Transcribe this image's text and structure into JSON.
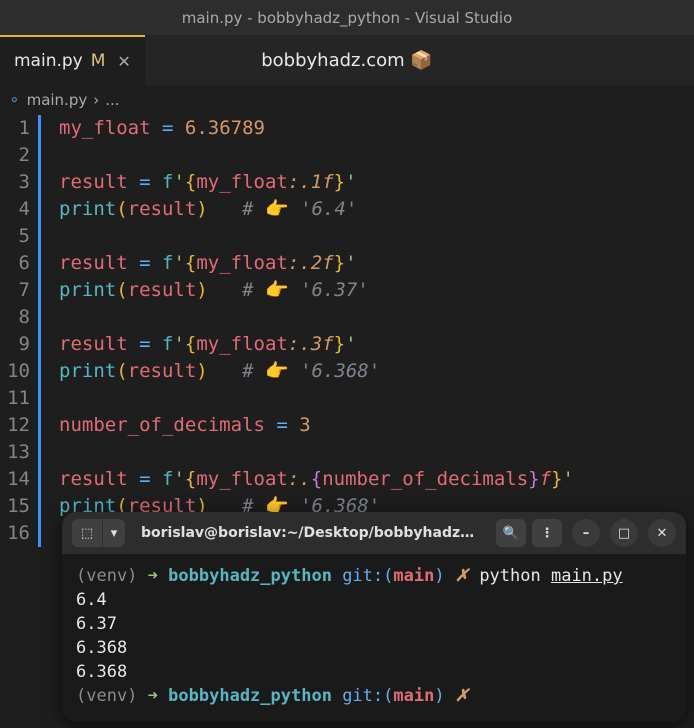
{
  "titlebar": "main.py - bobbyhadz_python - Visual Studio",
  "tab": {
    "name": "main.py",
    "modified": "M"
  },
  "watermark": "bobbyhadz.com 📦",
  "breadcrumb": {
    "file": "main.py",
    "sep": "›",
    "more": "..."
  },
  "code": {
    "lines": [
      {
        "n": 1,
        "tokens": [
          [
            "v",
            "my_float"
          ],
          [
            "p",
            " "
          ],
          [
            "o",
            "="
          ],
          [
            "p",
            " "
          ],
          [
            "n",
            "6.36789"
          ]
        ]
      },
      {
        "n": 2,
        "tokens": []
      },
      {
        "n": 3,
        "tokens": [
          [
            "v",
            "result"
          ],
          [
            "p",
            " "
          ],
          [
            "o",
            "="
          ],
          [
            "p",
            " "
          ],
          [
            "px",
            "f"
          ],
          [
            "s",
            "'"
          ],
          [
            "b",
            "{"
          ],
          [
            "fm",
            "my_float"
          ],
          [
            "sp",
            ":"
          ],
          [
            "sp",
            ".1f"
          ],
          [
            "b",
            "}"
          ],
          [
            "s",
            "'"
          ]
        ]
      },
      {
        "n": 4,
        "tokens": [
          [
            "f",
            "print"
          ],
          [
            "pr",
            "("
          ],
          [
            "v",
            "result"
          ],
          [
            "pr",
            ")"
          ],
          [
            "p",
            "   "
          ],
          [
            "c",
            "# "
          ],
          [
            "e",
            "👉"
          ],
          [
            "c",
            " '6.4'"
          ]
        ]
      },
      {
        "n": 5,
        "tokens": []
      },
      {
        "n": 6,
        "tokens": [
          [
            "v",
            "result"
          ],
          [
            "p",
            " "
          ],
          [
            "o",
            "="
          ],
          [
            "p",
            " "
          ],
          [
            "px",
            "f"
          ],
          [
            "s",
            "'"
          ],
          [
            "b",
            "{"
          ],
          [
            "fm",
            "my_float"
          ],
          [
            "sp",
            ":"
          ],
          [
            "sp",
            ".2f"
          ],
          [
            "b",
            "}"
          ],
          [
            "s",
            "'"
          ]
        ]
      },
      {
        "n": 7,
        "tokens": [
          [
            "f",
            "print"
          ],
          [
            "pr",
            "("
          ],
          [
            "v",
            "result"
          ],
          [
            "pr",
            ")"
          ],
          [
            "p",
            "   "
          ],
          [
            "c",
            "# "
          ],
          [
            "e",
            "👉"
          ],
          [
            "c",
            " '6.37'"
          ]
        ]
      },
      {
        "n": 8,
        "tokens": []
      },
      {
        "n": 9,
        "tokens": [
          [
            "v",
            "result"
          ],
          [
            "p",
            " "
          ],
          [
            "o",
            "="
          ],
          [
            "p",
            " "
          ],
          [
            "px",
            "f"
          ],
          [
            "s",
            "'"
          ],
          [
            "b",
            "{"
          ],
          [
            "fm",
            "my_float"
          ],
          [
            "sp",
            ":"
          ],
          [
            "sp",
            ".3f"
          ],
          [
            "b",
            "}"
          ],
          [
            "s",
            "'"
          ]
        ]
      },
      {
        "n": 10,
        "tokens": [
          [
            "f",
            "print"
          ],
          [
            "pr",
            "("
          ],
          [
            "v",
            "result"
          ],
          [
            "pr",
            ")"
          ],
          [
            "p",
            "   "
          ],
          [
            "c",
            "# "
          ],
          [
            "e",
            "👉"
          ],
          [
            "c",
            " '6.368'"
          ]
        ]
      },
      {
        "n": 11,
        "tokens": []
      },
      {
        "n": 12,
        "tokens": [
          [
            "v",
            "number_of_decimals"
          ],
          [
            "p",
            " "
          ],
          [
            "o",
            "="
          ],
          [
            "p",
            " "
          ],
          [
            "n",
            "3"
          ]
        ]
      },
      {
        "n": 13,
        "tokens": []
      },
      {
        "n": 14,
        "tokens": [
          [
            "v",
            "result"
          ],
          [
            "p",
            " "
          ],
          [
            "o",
            "="
          ],
          [
            "p",
            " "
          ],
          [
            "px",
            "f"
          ],
          [
            "s",
            "'"
          ],
          [
            "b",
            "{"
          ],
          [
            "fm",
            "my_float"
          ],
          [
            "sp",
            ":"
          ],
          [
            "sp",
            "."
          ],
          [
            "b2",
            "{"
          ],
          [
            "fm",
            "number_of_decimals"
          ],
          [
            "b2",
            "}"
          ],
          [
            "ff",
            "f"
          ],
          [
            "b",
            "}"
          ],
          [
            "s",
            "'"
          ]
        ]
      },
      {
        "n": 15,
        "tokens": [
          [
            "f",
            "print"
          ],
          [
            "pr",
            "("
          ],
          [
            "v",
            "result"
          ],
          [
            "pr",
            ")"
          ],
          [
            "p",
            "   "
          ],
          [
            "c",
            "# "
          ],
          [
            "e",
            "👉"
          ],
          [
            "c",
            " '6.368'"
          ]
        ]
      },
      {
        "n": 16,
        "tokens": []
      }
    ]
  },
  "terminal": {
    "title": "borislav@borislav:~/Desktop/bobbyhadz_...",
    "prompt": {
      "venv": "(venv)",
      "arrow": "➜",
      "folder": "bobbyhadz_python",
      "git": "git:(",
      "branch": "main",
      "gitclose": ")",
      "dirty": "✗"
    },
    "cmd": {
      "program": "python",
      "arg": "main.py"
    },
    "output": [
      "6.4",
      "6.37",
      "6.368",
      "6.368"
    ]
  },
  "icons": {
    "search": "🔍",
    "menu": "⋮",
    "minimize": "–",
    "maximize": "□",
    "close": "✕",
    "split": "⬚",
    "dropdown": "▾"
  }
}
